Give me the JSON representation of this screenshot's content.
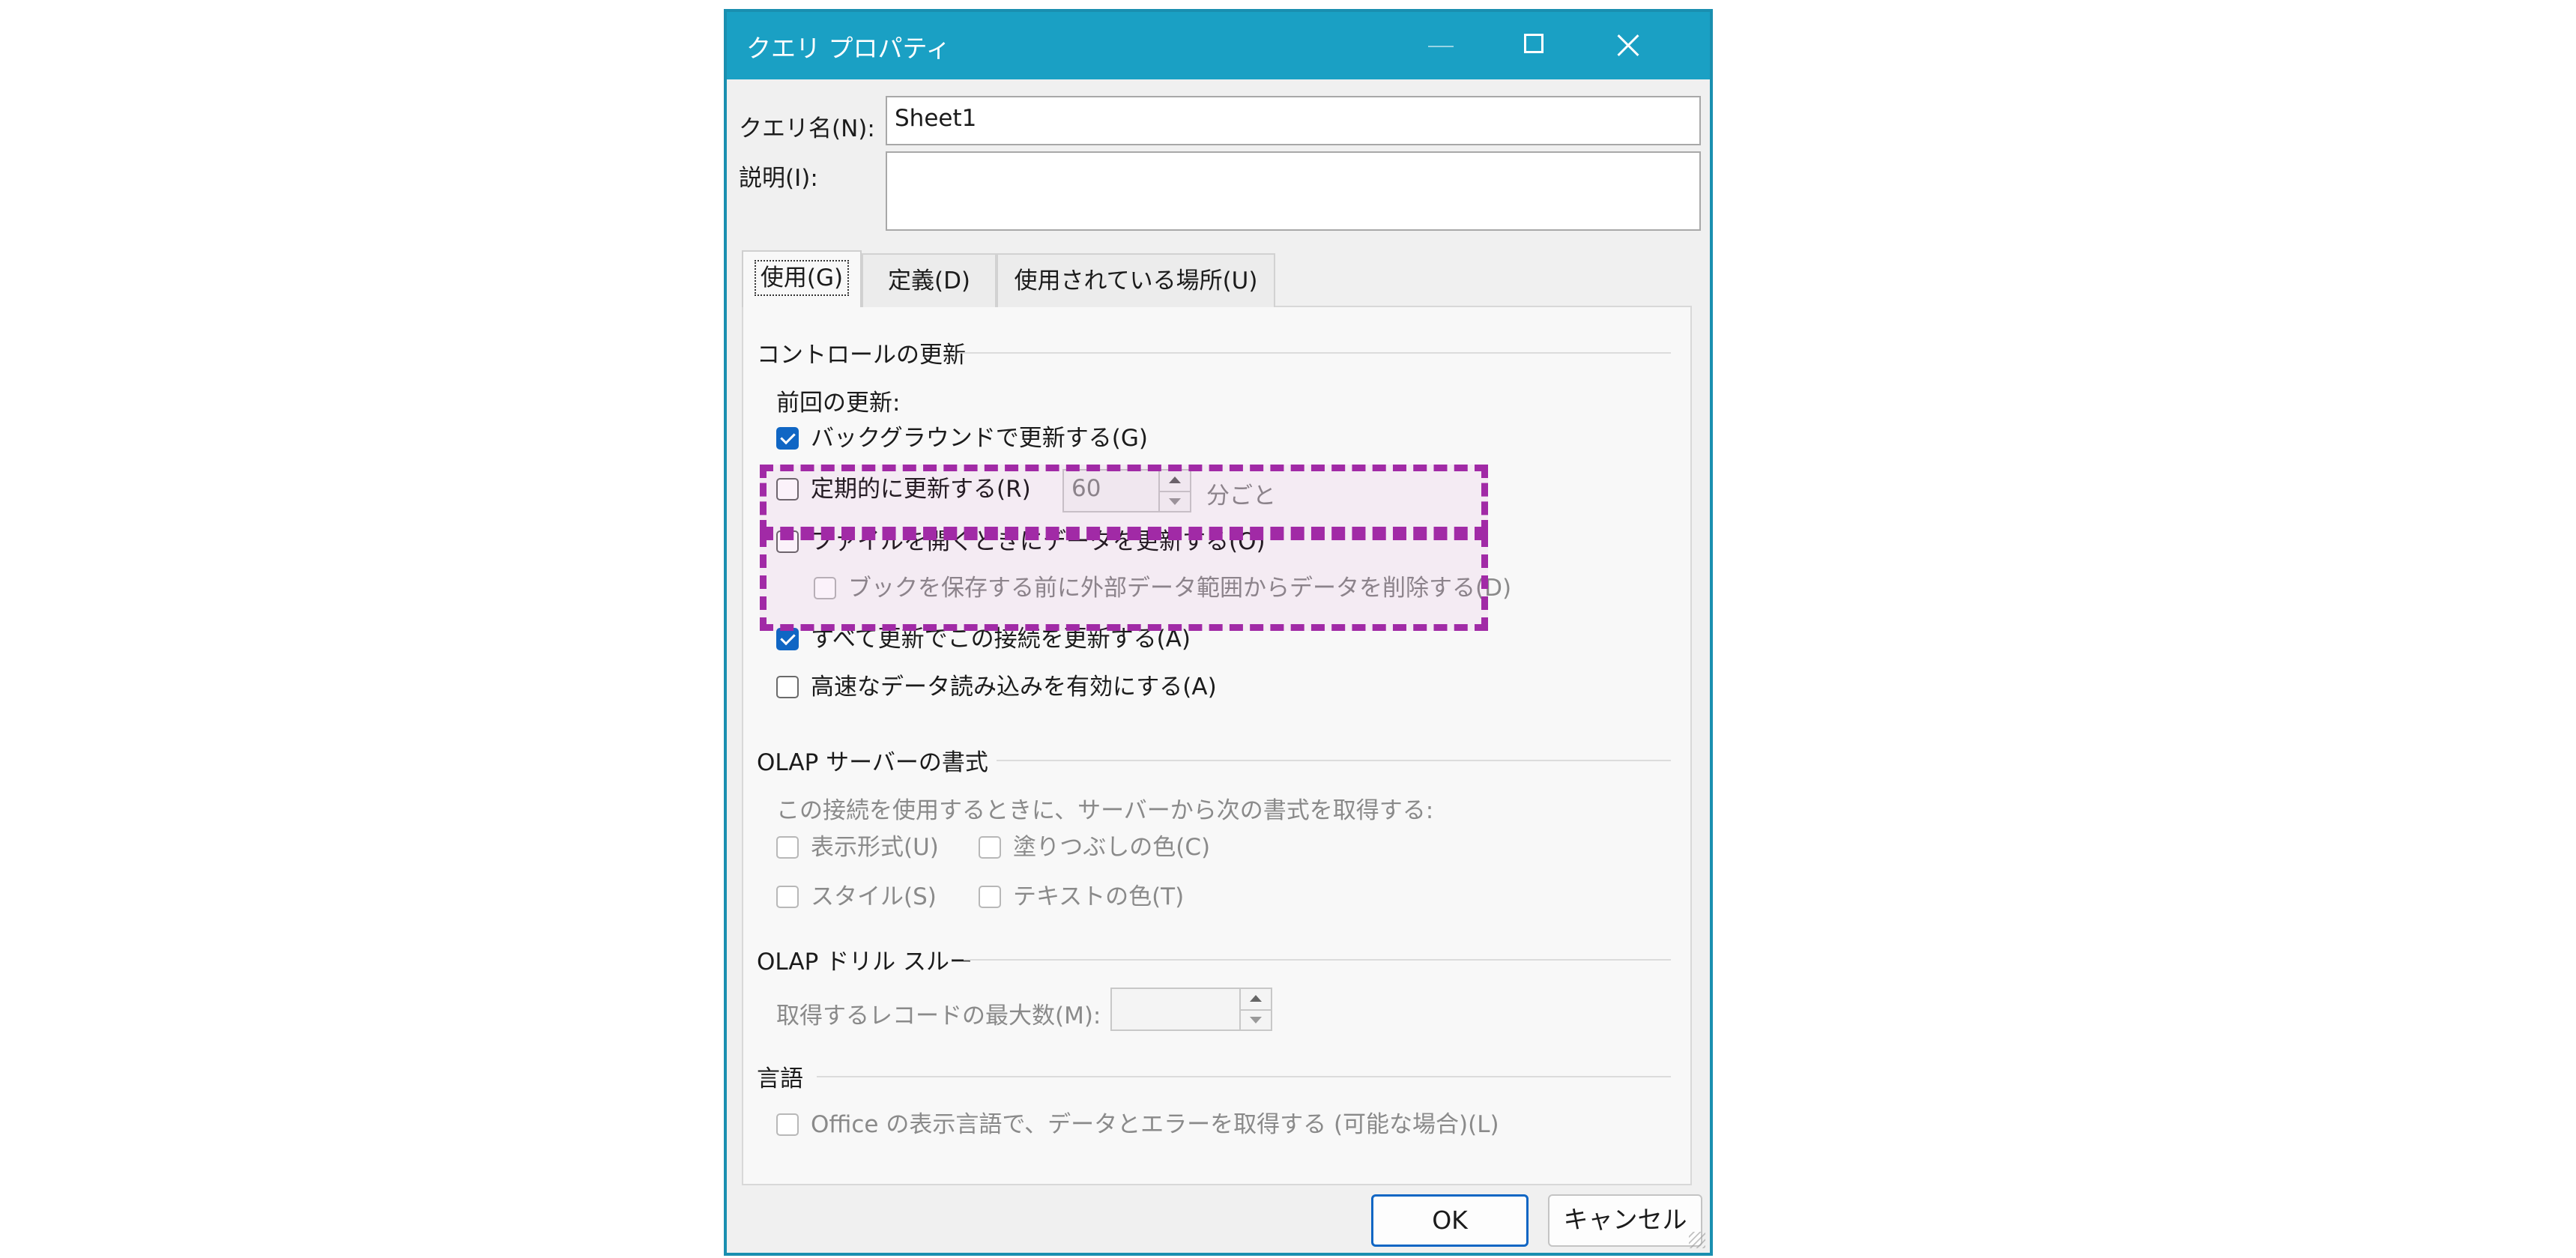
{
  "window": {
    "title": "クエリ プロパティ"
  },
  "form": {
    "name_label": "クエリ名(N):",
    "name_value": "Sheet1",
    "description_label": "説明(I):",
    "description_value": ""
  },
  "tabs": [
    {
      "label": "使用(G)"
    },
    {
      "label": "定義(D)"
    },
    {
      "label": "使用されている場所(U)"
    }
  ],
  "refresh_control": {
    "title": "コントロールの更新",
    "last_refresh_label": "前回の更新:",
    "background_refresh": "バックグラウンドで更新する(G)",
    "periodic_refresh": "定期的に更新する(R)",
    "periodic_minutes": "60",
    "periodic_unit": "分ごと",
    "refresh_on_open": "ファイルを開くときにデータを更新する(O)",
    "remove_external_data": "ブックを保存する前に外部データ範囲からデータを削除する(D)",
    "refresh_all": "すべて更新でこの接続を更新する(A)",
    "fast_load": "高速なデータ読み込みを有効にする(A)"
  },
  "olap_format": {
    "title": "OLAP サーバーの書式",
    "description": "この接続を使用するときに、サーバーから次の書式を取得する:",
    "number_format": "表示形式(U)",
    "fill_color": "塗りつぶしの色(C)",
    "style": "スタイル(S)",
    "text_color": "テキストの色(T)"
  },
  "olap_drill": {
    "title": "OLAP ドリル スルー",
    "max_records_label": "取得するレコードの最大数(M):",
    "max_records_value": ""
  },
  "language": {
    "title": "言語",
    "office_language": "Office の表示言語で、データとエラーを取得する (可能な場合)(L)"
  },
  "buttons": {
    "ok": "OK",
    "cancel": "キャンセル"
  },
  "colors": {
    "titlebar": "#1aa0c4",
    "checkbox_checked": "#1066c4",
    "highlight": "#a12aa6"
  }
}
